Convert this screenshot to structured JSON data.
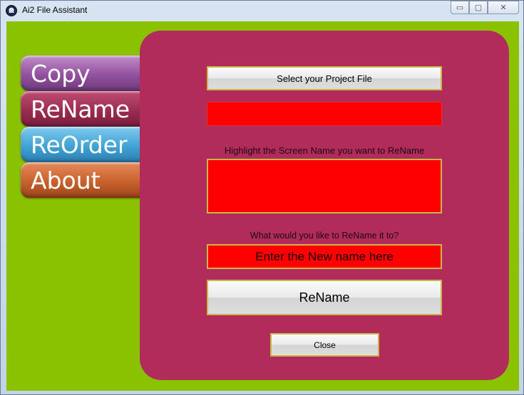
{
  "window": {
    "title": "Ai2 File Assistant",
    "buttons": {
      "minimize": "▭",
      "maximize": "▢",
      "close": "✕"
    }
  },
  "nav": {
    "items": [
      {
        "label": "Copy"
      },
      {
        "label": "ReName"
      },
      {
        "label": "ReOrder"
      },
      {
        "label": "About"
      }
    ]
  },
  "panel": {
    "select_button": "Select your Project File",
    "project_file_value": "",
    "highlight_label": "Highlight the Screen Name you want to ReName",
    "rename_label": "What would you like to ReName it to?",
    "new_name_placeholder": "Enter the New name here",
    "rename_button": "ReName",
    "close_button": "Close"
  },
  "colors": {
    "background": "#8ac100",
    "panel": "#b12c5b",
    "field": "#ff0000"
  },
  "icons": {
    "app": "ai2-logo-icon"
  }
}
